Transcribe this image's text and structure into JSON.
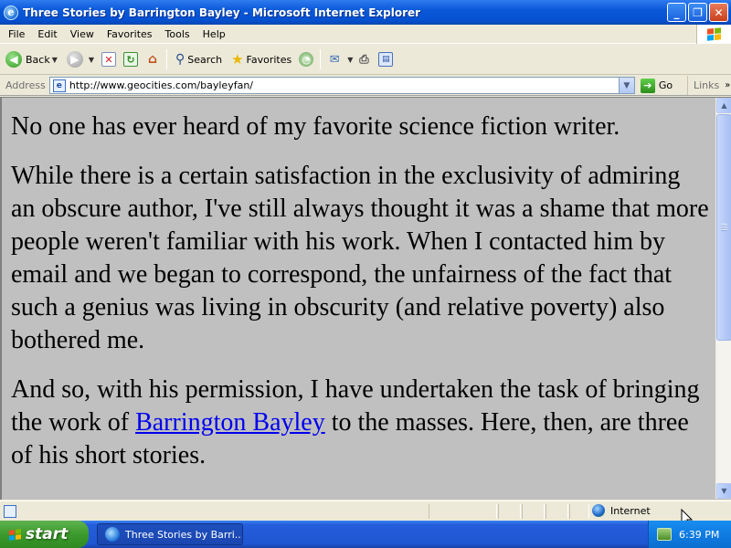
{
  "window": {
    "title": "Three Stories by Barrington Bayley - Microsoft Internet Explorer",
    "buttons": {
      "minimize": "_",
      "maximize": "❐",
      "close": "✕"
    }
  },
  "menu": [
    "File",
    "Edit",
    "View",
    "Favorites",
    "Tools",
    "Help"
  ],
  "toolbar": {
    "back_label": "Back",
    "search_label": "Search",
    "favorites_label": "Favorites"
  },
  "address": {
    "label": "Address",
    "url": "http://www.geocities.com/bayleyfan/",
    "go_label": "Go",
    "links_label": "Links"
  },
  "content": {
    "p1": "No one has ever heard of my favorite science fiction writer.",
    "p2": "While there is a certain satisfaction in the exclusivity of admiring an obscure author, I've still always thought it was a shame that more people weren't familiar with his work. When I contacted him by email and we began to correspond, the unfairness of the fact that such a genius was living in obscurity (and relative poverty) also bothered me.",
    "p3_before": "And so, with his permission, I have undertaken the task of bringing the work of ",
    "p3_link": "Barrington Bayley",
    "p3_after": " to the masses. Here, then, are three of his short stories."
  },
  "status": {
    "zone": "Internet"
  },
  "taskbar": {
    "start_label": "start",
    "task_label": "Three Stories by Barri...",
    "clock": "6:39 PM"
  },
  "colors": {
    "title_bar": "#0551d2",
    "page_background": "#c0c0c0",
    "link": "#0000ee",
    "start_button": "#3c9a2c"
  }
}
